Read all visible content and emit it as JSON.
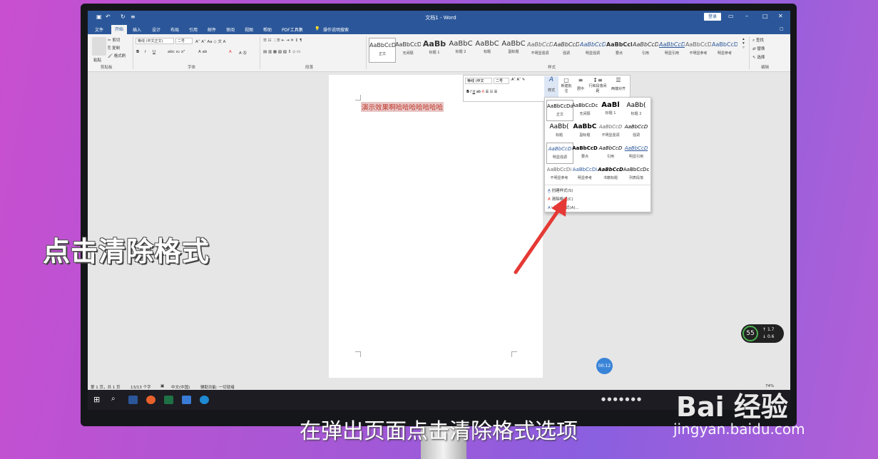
{
  "app": {
    "title": "文档1 - Word",
    "login_label": "登录"
  },
  "tabs": [
    "文件",
    "开始",
    "插入",
    "设计",
    "布局",
    "引用",
    "邮件",
    "审阅",
    "视图",
    "帮助",
    "PDF工具集",
    "操作说明搜索"
  ],
  "ribbon": {
    "clipboard": {
      "paste": "粘贴",
      "cut": "剪切",
      "copy": "复制",
      "format_painter": "格式刷",
      "group": "剪贴板"
    },
    "font": {
      "font_name": "等线 (中文正文)",
      "font_size": "二号",
      "group": "字体"
    },
    "paragraph": {
      "group": "段落"
    },
    "styles": {
      "group": "样式",
      "tiles": [
        {
          "sample": "AaBbCcDc",
          "name": "正文"
        },
        {
          "sample": "AaBbCcDc",
          "name": "无间隔"
        },
        {
          "sample": "AaBb",
          "name": "标题 1"
        },
        {
          "sample": "AaBbC",
          "name": "标题 2"
        },
        {
          "sample": "AaBbC",
          "name": "标题"
        },
        {
          "sample": "AaBbC",
          "name": "副标题"
        },
        {
          "sample": "AaBbCcD",
          "name": "不明显强调"
        },
        {
          "sample": "AaBbCcD",
          "name": "强调"
        },
        {
          "sample": "AaBbCcD",
          "name": "明显强调"
        },
        {
          "sample": "AaBbCcD",
          "name": "要点"
        },
        {
          "sample": "AaBbCcD",
          "name": "引用"
        },
        {
          "sample": "AaBbCcD",
          "name": "明显引用"
        },
        {
          "sample": "AaBbCcD",
          "name": "不明显参考"
        },
        {
          "sample": "AaBbCcD",
          "name": "明显参考"
        }
      ]
    },
    "editing": {
      "find": "查找",
      "replace": "替换",
      "select": "选择",
      "group": "编辑"
    }
  },
  "document": {
    "text": "演示效果啊哈哈哈哈哈哈哈"
  },
  "mini_toolbar": {
    "font_name": "等线 (中文",
    "font_size": "二号",
    "styles": "样式",
    "new_comment": "新建批注",
    "center": "居中",
    "line_spacing": "行和段落间距",
    "justify": "两端对齐"
  },
  "styles_popup": {
    "tiles": [
      {
        "sample": "AaBbCcDc",
        "name": "正文"
      },
      {
        "sample": "AaBbCcDc",
        "name": "无间隔"
      },
      {
        "sample": "AaBl",
        "name": "标题 1"
      },
      {
        "sample": "AaBb(",
        "name": "标题 2"
      },
      {
        "sample": "AaBb(",
        "name": "标题"
      },
      {
        "sample": "AaBbC",
        "name": "副标题"
      },
      {
        "sample": "AaBbCcD",
        "name": "不明显强调"
      },
      {
        "sample": "AaBbCcD",
        "name": "强调"
      },
      {
        "sample": "AaBbCcD",
        "name": "明显强调"
      },
      {
        "sample": "AaBbCcD",
        "name": "要点"
      },
      {
        "sample": "AaBbCcD",
        "name": "引用"
      },
      {
        "sample": "AaBbCcD",
        "name": "明显引用"
      },
      {
        "sample": "AaBbCcDi",
        "name": "不明显参考"
      },
      {
        "sample": "AaBbCcDi",
        "name": "明显参考"
      },
      {
        "sample": "AaBbCcD",
        "name": "书籍标题"
      },
      {
        "sample": "AaBbCcDc",
        "name": "列表段落"
      }
    ],
    "create_style": "创建样式(S)",
    "clear_format": "清除格式(C)",
    "apply_styles": "应用样式(A)..."
  },
  "statusbar": {
    "page": "第 1 页，共 1 页",
    "words": "13/13 个字",
    "language": "中文(中国)",
    "accessibility": "辅助功能: 一切就绪",
    "zoom": "74%"
  },
  "timer": "00:12",
  "net_widget": {
    "percent": "55",
    "up": "1.7",
    "down": "0.6"
  },
  "overlay": {
    "title": "点击清除格式",
    "subtitle": "在弹出页面点击清除格式选项"
  },
  "watermark": {
    "brand": "Bai 经验",
    "url": "jingyan.baidu.com"
  },
  "colors": {
    "word_blue": "#2b579a",
    "arrow_red": "#e53935"
  }
}
